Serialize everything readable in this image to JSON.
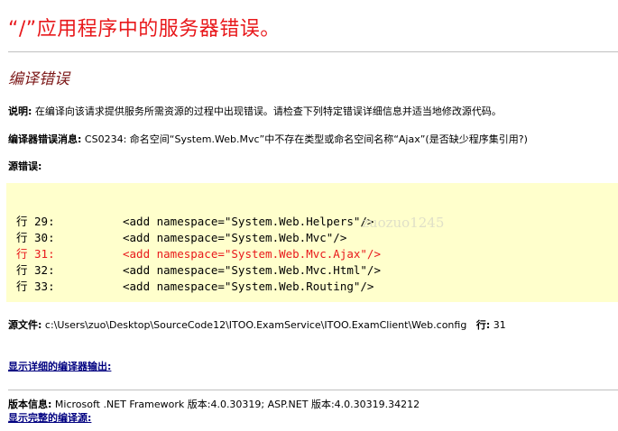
{
  "header": {
    "title": "“/”应用程序中的服务器错误。"
  },
  "section": {
    "subtitle": "编译错误"
  },
  "description": {
    "label": "说明:",
    "text": "在编译向该请求提供服务所需资源的过程中出现错误。请检查下列特定错误详细信息并适当地修改源代码。"
  },
  "compiler_error": {
    "label": "编译器错误消息:",
    "text": "CS0234: 命名空间“System.Web.Mvc”中不存在类型或命名空间名称“Ajax”(是否缺少程序集引用?)"
  },
  "source_error": {
    "label": "源错误:",
    "lines": [
      {
        "num": "行 29:",
        "code": "<add namespace=\"System.Web.Helpers\"/>",
        "is_error": false
      },
      {
        "num": "行 30:",
        "code": "<add namespace=\"System.Web.Mvc\"/>",
        "is_error": false
      },
      {
        "num": "行 31:",
        "code": "<add namespace=\"System.Web.Mvc.Ajax\"/>",
        "is_error": true
      },
      {
        "num": "行 32:",
        "code": "<add namespace=\"System.Web.Mvc.Html\"/>",
        "is_error": false
      },
      {
        "num": "行 33:",
        "code": "<add namespace=\"System.Web.Routing\"/>",
        "is_error": false
      }
    ],
    "watermark": "zuozuo1245"
  },
  "source_file": {
    "label": "源文件:",
    "path": "c:\\Users\\zuo\\Desktop\\SourceCode12\\ITOO.ExamService\\ITOO.ExamClient\\Web.config",
    "line_label": "行:",
    "line_value": "31"
  },
  "links": {
    "show_compiler_output": "显示详细的编译器输出:",
    "show_full_source": "显示完整的编译源:"
  },
  "version": {
    "label": "版本信息:",
    "text": "Microsoft .NET Framework 版本:4.0.30319; ASP.NET 版本:4.0.30319.34212"
  },
  "colors": {
    "title": "#e8181b",
    "subtitle": "#7d1a1a",
    "code_background": "#ffffcc",
    "error_line": "#e8181b",
    "link": "#000080"
  }
}
